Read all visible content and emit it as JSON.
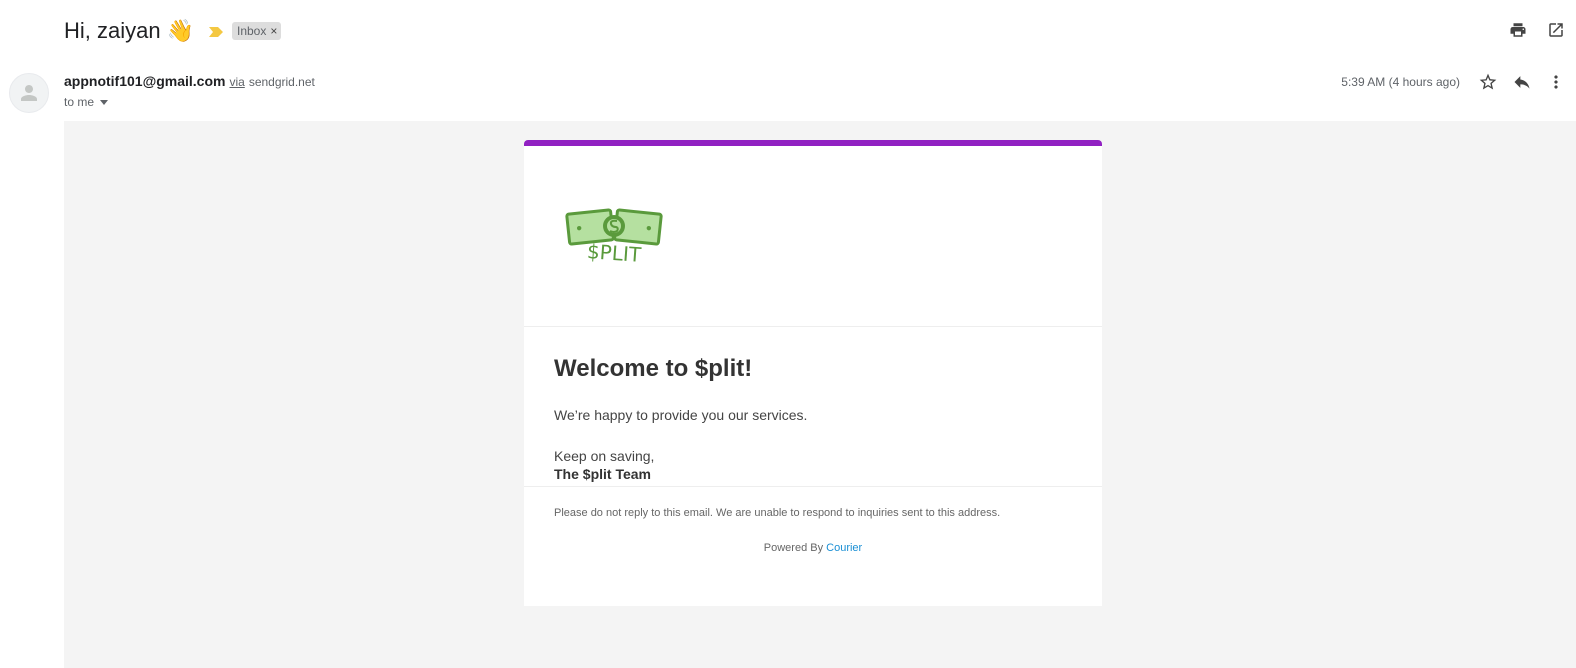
{
  "header": {
    "subject": "Hi, zaiyan",
    "subject_emoji": "👋",
    "label": "Inbox",
    "label_remove": "×"
  },
  "message": {
    "sender_email": "appnotif101@gmail.com",
    "via_label": "via",
    "via_domain": "sendgrid.net",
    "to_label": "to me",
    "time": "5:39 AM (4 hours ago)"
  },
  "email_body": {
    "logo_text": "$PLIT",
    "headline": "Welcome to $plit!",
    "paragraph": "We’re happy to provide you our services.",
    "signoff": "Keep on saving,",
    "team": "The $plit Team",
    "disclaimer": "Please do not reply to this email. We are unable to respond to inquiries sent to this address.",
    "powered_by": "Powered By",
    "powered_link": "Courier"
  },
  "colors": {
    "accent_bar": "#9121c2",
    "logo_green": "#5a9a3c",
    "bill_fill": "#b5e0a0",
    "link": "#1a8fd4"
  },
  "icons": [
    "print-icon",
    "open-new-window-icon",
    "star-icon",
    "reply-icon",
    "more-vert-icon",
    "importance-marker-icon",
    "person-icon",
    "dropdown-caret-icon"
  ]
}
